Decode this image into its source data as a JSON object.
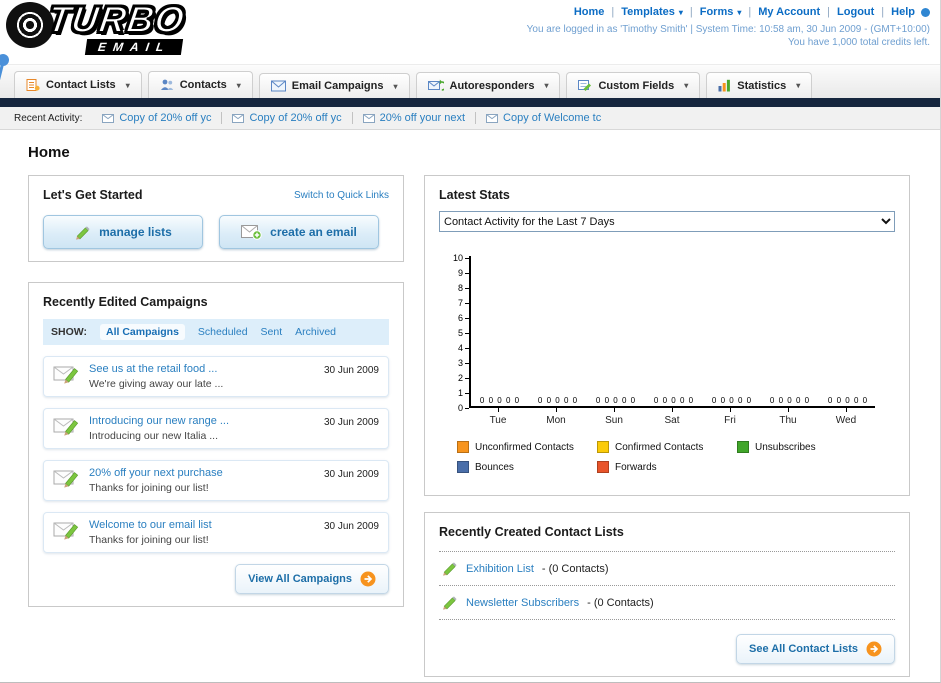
{
  "header": {
    "logo": {
      "title": "TURBO",
      "subtitle": "EMAIL"
    },
    "top_links": [
      {
        "label": "Home",
        "caret": false
      },
      {
        "label": "Templates",
        "caret": true
      },
      {
        "label": "Forms",
        "caret": true
      },
      {
        "label": "My Account",
        "caret": false
      },
      {
        "label": "Logout",
        "caret": false
      },
      {
        "label": "Help",
        "caret": false
      }
    ],
    "login_info": "You are logged in as 'Timothy Smith' | System Time: 10:58 am, 30 Jun 2009 - (GMT+10:00)",
    "credits_info": "You have 1,000 total credits left."
  },
  "main_nav": {
    "items": [
      {
        "label": "Contact Lists",
        "icon": "contact-lists-icon"
      },
      {
        "label": "Contacts",
        "icon": "contacts-icon"
      },
      {
        "label": "Email Campaigns",
        "icon": "email-campaigns-icon"
      },
      {
        "label": "Autoresponders",
        "icon": "autoresponders-icon"
      },
      {
        "label": "Custom Fields",
        "icon": "custom-fields-icon"
      },
      {
        "label": "Statistics",
        "icon": "statistics-icon"
      }
    ]
  },
  "recent_activity": {
    "label": "Recent Activity:",
    "items": [
      {
        "label": "Copy of 20% off yc",
        "icon": "envelope-icon"
      },
      {
        "label": "Copy of 20% off yc",
        "icon": "envelope-icon"
      },
      {
        "label": "20% off your next",
        "icon": "envelope-icon"
      },
      {
        "label": "Copy of Welcome tc",
        "icon": "envelope-icon"
      }
    ]
  },
  "page_title": "Home",
  "get_started": {
    "title": "Let's Get Started",
    "switch_link": "Switch to Quick Links",
    "buttons": [
      {
        "label": "manage lists",
        "icon": "pencil-icon"
      },
      {
        "label": "create an email",
        "icon": "envelope-plus-icon"
      }
    ]
  },
  "campaigns": {
    "title": "Recently Edited Campaigns",
    "show_label": "SHOW:",
    "filters": [
      "All Campaigns",
      "Scheduled",
      "Sent",
      "Archived"
    ],
    "active_filter": "All Campaigns",
    "items": [
      {
        "title": "See us at the retail food ...",
        "subtitle": "We're giving away our late ...",
        "date": "30 Jun 2009"
      },
      {
        "title": "Introducing our new range ...",
        "subtitle": "Introducing our new Italia ...",
        "date": "30 Jun 2009"
      },
      {
        "title": "20% off your next purchase",
        "subtitle": "Thanks for joining our list!",
        "date": "30 Jun 2009"
      },
      {
        "title": "Welcome to our email list",
        "subtitle": "Thanks for joining our list!",
        "date": "30 Jun 2009"
      }
    ],
    "view_all_label": "View All Campaigns"
  },
  "stats": {
    "title": "Latest Stats",
    "period_select": "Contact Activity for the Last 7 Days"
  },
  "chart_data": {
    "type": "bar",
    "title": "Contact Activity for the Last 7 Days",
    "categories": [
      "Tue",
      "Mon",
      "Sun",
      "Sat",
      "Fri",
      "Thu",
      "Wed"
    ],
    "series": [
      {
        "name": "Unconfirmed Contacts",
        "color": "#f7941d",
        "values": [
          0,
          0,
          0,
          0,
          0,
          0,
          0
        ]
      },
      {
        "name": "Confirmed Contacts",
        "color": "#fbcb09",
        "values": [
          0,
          0,
          0,
          0,
          0,
          0,
          0
        ]
      },
      {
        "name": "Unsubscribes",
        "color": "#41a62a",
        "values": [
          0,
          0,
          0,
          0,
          0,
          0,
          0
        ]
      },
      {
        "name": "Bounces",
        "color": "#4a6ea9",
        "values": [
          0,
          0,
          0,
          0,
          0,
          0,
          0
        ]
      },
      {
        "name": "Forwards",
        "color": "#e8542a",
        "values": [
          0,
          0,
          0,
          0,
          0,
          0,
          0
        ]
      }
    ],
    "ylim": [
      0,
      10
    ],
    "yticks": [
      0,
      1,
      2,
      3,
      4,
      5,
      6,
      7,
      8,
      9,
      10
    ],
    "bar_value_labels": true,
    "legend_position": "bottom",
    "grid": false
  },
  "contact_lists": {
    "title": "Recently Created Contact Lists",
    "items": [
      {
        "name": "Exhibition List",
        "detail": "- (0 Contacts)",
        "icon": "pencil-icon"
      },
      {
        "name": "Newsletter Subscribers",
        "detail": "- (0 Contacts)",
        "icon": "pencil-icon"
      }
    ],
    "see_all_label": "See All Contact Lists"
  }
}
